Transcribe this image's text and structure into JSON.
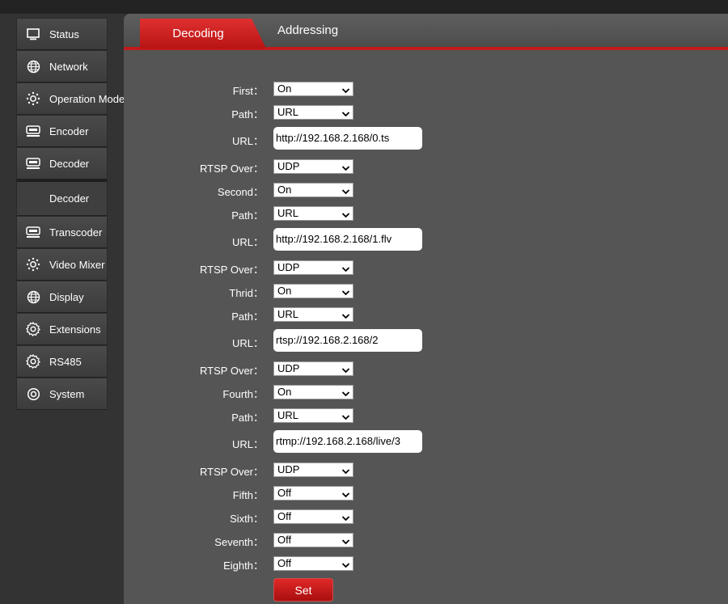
{
  "sidebar": {
    "items": [
      {
        "label": "Status",
        "icon": "monitor-icon"
      },
      {
        "label": "Network",
        "icon": "globe-icon"
      },
      {
        "label": "Operation Mode",
        "icon": "gear-icon"
      },
      {
        "label": "Encoder",
        "icon": "device-icon"
      },
      {
        "label": "Decoder",
        "icon": "device-icon"
      },
      {
        "label": "Decoder",
        "icon": ""
      },
      {
        "label": "Transcoder",
        "icon": "device-icon"
      },
      {
        "label": "Video Mixer",
        "icon": "gear-icon"
      },
      {
        "label": "Display",
        "icon": "globe-icon"
      },
      {
        "label": "Extensions",
        "icon": "cog-icon"
      },
      {
        "label": "RS485",
        "icon": "cog-icon"
      },
      {
        "label": "System",
        "icon": "target-icon"
      }
    ]
  },
  "tabs": {
    "active": "Decoding",
    "inactive": "Addressing"
  },
  "form": {
    "rows": [
      {
        "label": "First：",
        "value": "On"
      },
      {
        "label": "Path：",
        "value": "URL"
      },
      {
        "label": "URL：",
        "value": "http://192.168.2.168/0.ts"
      },
      {
        "label": "RTSP Over：",
        "value": "UDP"
      },
      {
        "label": "Second：",
        "value": "On"
      },
      {
        "label": "Path：",
        "value": "URL"
      },
      {
        "label": "URL：",
        "value": "http://192.168.2.168/1.flv"
      },
      {
        "label": "RTSP Over：",
        "value": "UDP"
      },
      {
        "label": "Thrid：",
        "value": "On"
      },
      {
        "label": "Path：",
        "value": "URL"
      },
      {
        "label": "URL：",
        "value": "rtsp://192.168.2.168/2"
      },
      {
        "label": "RTSP Over：",
        "value": "UDP"
      },
      {
        "label": "Fourth：",
        "value": "On"
      },
      {
        "label": "Path：",
        "value": "URL"
      },
      {
        "label": "URL：",
        "value": "rtmp://192.168.2.168/live/3"
      },
      {
        "label": "RTSP Over：",
        "value": "UDP"
      },
      {
        "label": "Fifth：",
        "value": "Off"
      },
      {
        "label": "Sixth：",
        "value": "Off"
      },
      {
        "label": "Seventh：",
        "value": "Off"
      },
      {
        "label": "Eighth：",
        "value": "Off"
      }
    ],
    "set_label": "Set"
  },
  "colors": {
    "accent": "#c01a1a",
    "panel": "#555555",
    "sidebar": "#444444",
    "background": "#333333"
  }
}
